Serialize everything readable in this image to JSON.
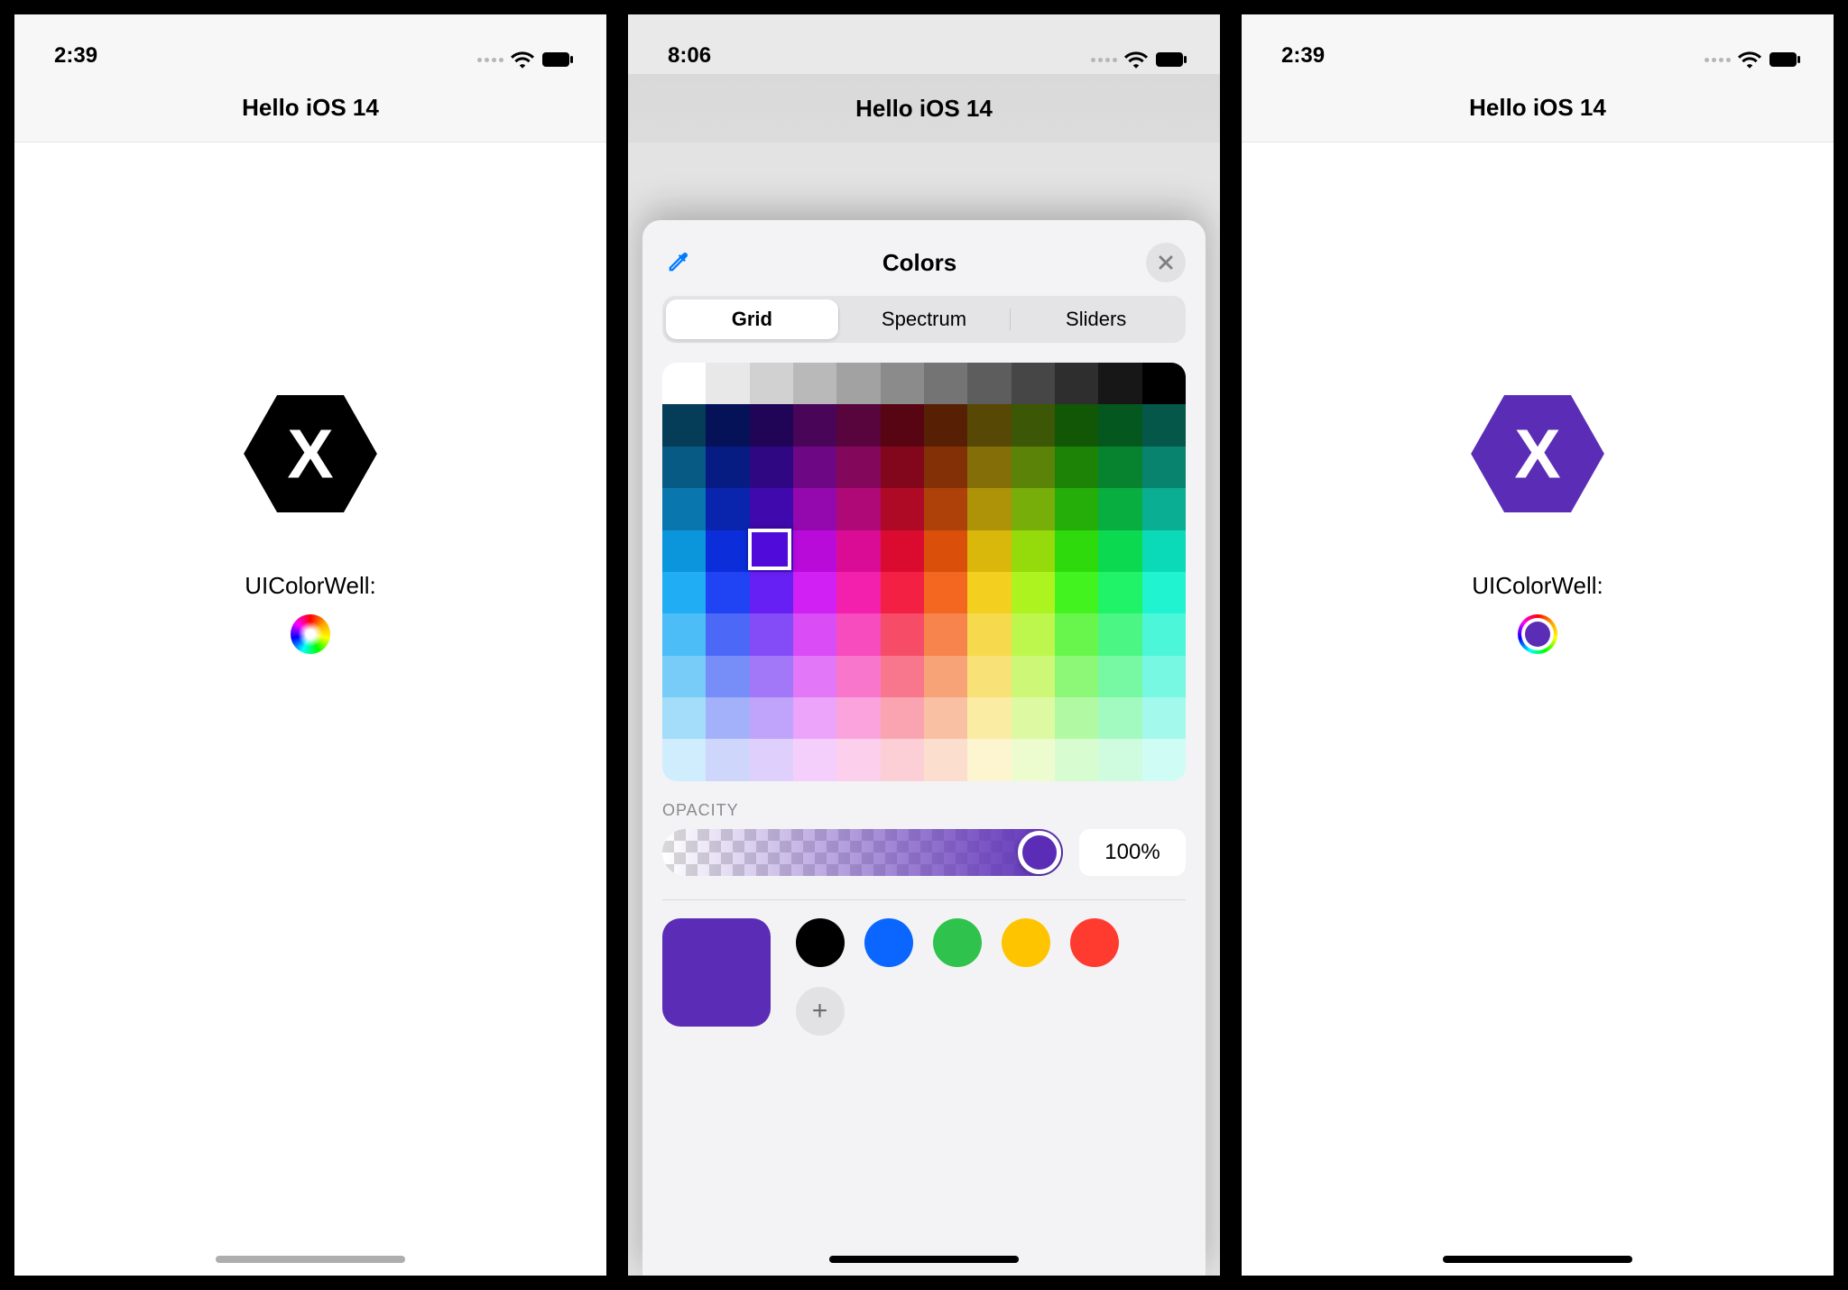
{
  "screens": {
    "left": {
      "time": "2:39",
      "nav_title": "Hello iOS 14",
      "well_label": "UIColorWell:",
      "hex_color": "#000000"
    },
    "mid": {
      "time": "8:06",
      "nav_title": "Hello iOS 14"
    },
    "right": {
      "time": "2:39",
      "nav_title": "Hello iOS 14",
      "well_label": "UIColorWell:",
      "hex_color": "#5B2DB6",
      "well_fill": "#5B2DB6"
    }
  },
  "picker": {
    "title": "Colors",
    "tabs": {
      "grid": "Grid",
      "spectrum": "Spectrum",
      "sliders": "Sliders",
      "selected": "grid"
    },
    "opacity": {
      "label": "OPACITY",
      "value_text": "100%",
      "value_pct": 100,
      "track_color": "#5B2DB6"
    },
    "current_color": "#5B2DB6",
    "recent_swatches": [
      "#000000",
      "#0A66FF",
      "#2FC24C",
      "#FFC400",
      "#FF3B30"
    ],
    "grid_selection": {
      "col": 2,
      "row": 4
    },
    "grid_colors": [
      "#FFFFFF",
      "#EBEBEB",
      "#D6D6D6",
      "#C2C2C2",
      "#ADADAD",
      "#999999",
      "#858585",
      "#707070",
      "#5C5C5C",
      "#474747",
      "#333333",
      "#000000",
      "#00374A",
      "#004D65",
      "#016E8F",
      "#008CB4",
      "#00A1D8",
      "#01C7FC",
      "#2ED0FD",
      "#59DBFD",
      "#86E5FE",
      "#B3EFFE",
      "#D9F7FE",
      "#ECFBFF",
      "#011D57",
      "#012F7B",
      "#0042A9",
      "#0056D6",
      "#016DFF",
      "#3A87FE",
      "#6BA1FE",
      "#8DB6FE",
      "#AECCFE",
      "#CFE1FE",
      "#E7F0FE",
      "#F3F7FF",
      "#11053B",
      "#1A0A52",
      "#2C0977",
      "#371A94",
      "#4D22B2",
      "#5B2DB6",
      "#7C4ECF",
      "#9973DC",
      "#B79CE8",
      "#D5C4F3",
      "#EAE1F9",
      "#F4F0FC",
      "#2E063D",
      "#450D59",
      "#61187C",
      "#7A219E",
      "#9829B8",
      "#BE38F3",
      "#CF60F5",
      "#DA85F7",
      "#E6ABFA",
      "#F1D0FC",
      "#F8E7FD",
      "#FBF3FE",
      "#3C071B",
      "#551029",
      "#791A3D",
      "#99244F",
      "#B92D5D",
      "#E63B7A",
      "#EC6293",
      "#F189AD",
      "#F6B0C7",
      "#FAD7E2",
      "#FCEBF0",
      "#FEF5F8",
      "#5C0701",
      "#831100",
      "#B51A00",
      "#E22400",
      "#FF4015",
      "#FF6250",
      "#FF8376",
      "#FFA39A",
      "#FFC2BD",
      "#FFE0DE",
      "#FFEFEE",
      "#FFF7F7",
      "#5A1C00",
      "#7B2900",
      "#AD3E00",
      "#DA5100",
      "#FF6A00",
      "#FF8648",
      "#FFA374",
      "#FFC09E",
      "#FFDCC8",
      "#FFEDE3",
      "#FFF6F1",
      "#FFFBF8",
      "#583300",
      "#7A4A00",
      "#A96800",
      "#D38301",
      "#FFAB01",
      "#FEB43F",
      "#FEC473",
      "#FED6A3",
      "#FEE7D0",
      "#FEF3E7",
      "#FEF9F3",
      "#FEFCF9",
      "#563D00",
      "#785800",
      "#A67B01",
      "#D19D01",
      "#FDC700",
      "#FDD231",
      "#FDDD67",
      "#FEE89A",
      "#FEF2CB",
      "#FEF8E5",
      "#FEFBF2",
      "#FEFDF8"
    ]
  }
}
